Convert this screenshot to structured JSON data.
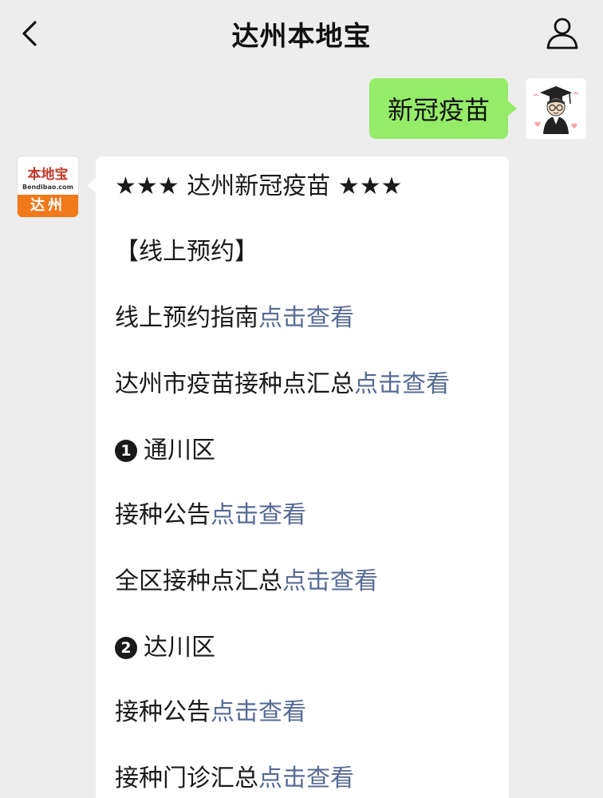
{
  "nav": {
    "title": "达州本地宝",
    "back_icon": "chevron-left-icon",
    "profile_icon": "person-icon"
  },
  "outgoing": {
    "text": "新冠疫苗",
    "bubble_color": "#95ec69"
  },
  "bot": {
    "avatar": {
      "logo_text": "本地宝",
      "logo_url": "Bendibao.com",
      "city": "达州",
      "accent": "#f07a1a"
    },
    "heading": "★★★ 达州新冠疫苗 ★★★",
    "section_online": "【线上预约】",
    "lines": [
      {
        "text": "线上预约指南",
        "link": "点击查看"
      },
      {
        "text": "达州市疫苗接种点汇总",
        "link": "点击查看"
      }
    ],
    "districts": [
      {
        "badge": "1",
        "name": "通川区",
        "lines": [
          {
            "text": "接种公告",
            "link": "点击查看"
          },
          {
            "text": "全区接种点汇总",
            "link": "点击查看"
          }
        ]
      },
      {
        "badge": "2",
        "name": "达川区",
        "lines": [
          {
            "text": "接种公告",
            "link": "点击查看"
          },
          {
            "text": "接种门诊汇总",
            "link": "点击查看"
          }
        ]
      }
    ],
    "link_color": "#576b95"
  }
}
